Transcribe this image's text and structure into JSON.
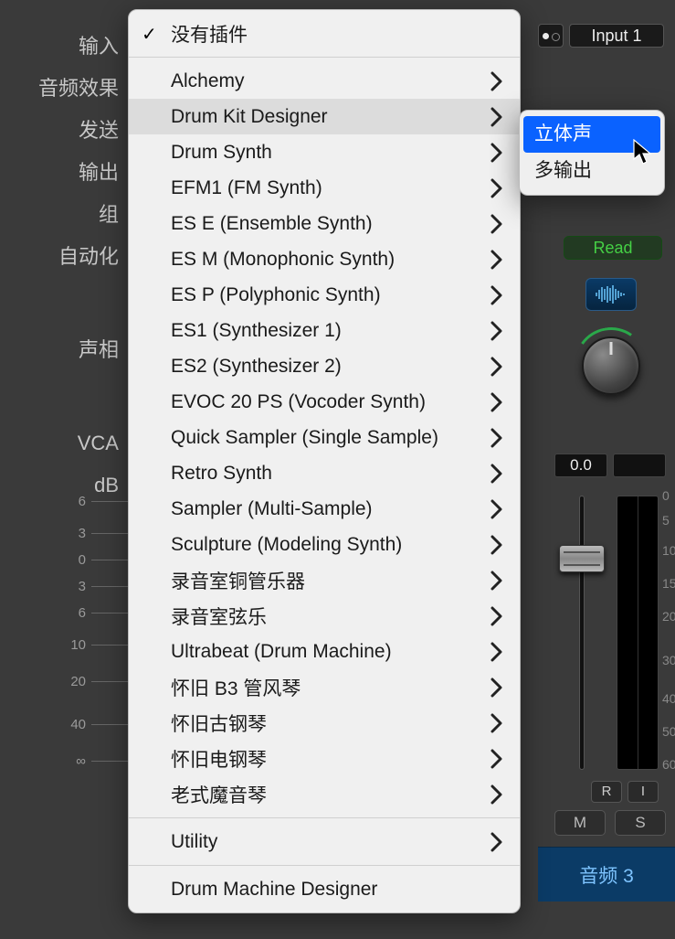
{
  "left_labels": {
    "input": "输入",
    "audiofx": "音频效果",
    "sends": "发送",
    "output": "输出",
    "group": "组",
    "automation": "自动化",
    "pan": "声相",
    "vca": "VCA",
    "db": "dB"
  },
  "db_ticks": [
    "6",
    "3",
    "0",
    "3",
    "6",
    "10",
    "20",
    "40",
    "∞"
  ],
  "menu": {
    "no_plugin": "没有插件",
    "items": [
      "Alchemy",
      "Drum Kit Designer",
      "Drum Synth",
      "EFM1  (FM Synth)",
      "ES E  (Ensemble Synth)",
      "ES M  (Monophonic Synth)",
      "ES P  (Polyphonic Synth)",
      "ES1  (Synthesizer 1)",
      "ES2  (Synthesizer 2)",
      "EVOC 20 PS  (Vocoder Synth)",
      "Quick Sampler (Single Sample)",
      "Retro Synth",
      "Sampler (Multi-Sample)",
      "Sculpture  (Modeling Synth)",
      "录音室铜管乐器",
      "录音室弦乐",
      "Ultrabeat (Drum Machine)",
      "怀旧 B3 管风琴",
      "怀旧古钢琴",
      "怀旧电钢琴",
      "老式魔音琴"
    ],
    "utility": "Utility",
    "dmd": "Drum Machine Designer",
    "hovered_index": 1
  },
  "submenu": {
    "items": [
      "立体声",
      "多输出"
    ],
    "selected_index": 0
  },
  "strip": {
    "input": "Input 1",
    "read": "Read",
    "db_value": "0.0",
    "rec": "R",
    "inmon": "I",
    "mute": "M",
    "solo": "S",
    "track_name": "音频 3"
  },
  "meter_scale": [
    "0",
    "5",
    "10",
    "15",
    "20",
    "30",
    "40",
    "50",
    "60"
  ]
}
